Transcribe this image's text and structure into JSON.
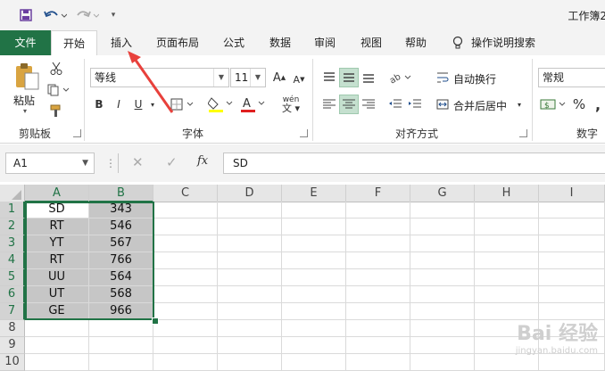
{
  "window": {
    "title": "工作簿2"
  },
  "tabs": [
    {
      "label": "文件"
    },
    {
      "label": "开始"
    },
    {
      "label": "插入"
    },
    {
      "label": "页面布局"
    },
    {
      "label": "公式"
    },
    {
      "label": "数据"
    },
    {
      "label": "审阅"
    },
    {
      "label": "视图"
    },
    {
      "label": "帮助"
    },
    {
      "label": "操作说明搜索"
    }
  ],
  "ribbon": {
    "clipboard": {
      "paste_label": "粘贴",
      "group_label": "剪贴板"
    },
    "font": {
      "font_name": "等线",
      "font_size": "11",
      "group_label": "字体",
      "bold": "B",
      "italic": "I",
      "underline": "U",
      "phonetic": "wén"
    },
    "alignment": {
      "wrap_text": "自动换行",
      "merge_center": "合并后居中",
      "group_label": "对齐方式"
    },
    "number": {
      "format": "常规",
      "percent": "%",
      "comma": ",",
      "group_label": "数字"
    }
  },
  "formula_bar": {
    "name_box": "A1",
    "fx": "fx",
    "content": "SD"
  },
  "columns": [
    "A",
    "B",
    "C",
    "D",
    "E",
    "F",
    "G",
    "H",
    "I"
  ],
  "rows": [
    "1",
    "2",
    "3",
    "4",
    "5",
    "6",
    "7",
    "8",
    "9",
    "10"
  ],
  "data": [
    [
      "SD",
      "343"
    ],
    [
      "RT",
      "546"
    ],
    [
      "YT",
      "567"
    ],
    [
      "RT",
      "766"
    ],
    [
      "UU",
      "564"
    ],
    [
      "UT",
      "568"
    ],
    [
      "GE",
      "966"
    ]
  ],
  "watermark": {
    "brand": "Bai 经验",
    "url": "jingyan.baidu.com"
  },
  "colors": {
    "accent": "#217346",
    "selection_fill": "#c6c6c6",
    "arrow": "#e8413c"
  }
}
